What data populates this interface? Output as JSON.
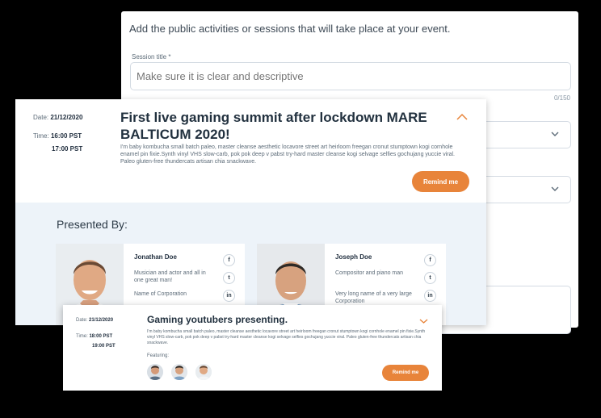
{
  "form": {
    "intro": "Add the public activities or sessions that will take place at your event.",
    "session_title_label": "Session title *",
    "session_title_placeholder": "Make sure it is clear and descriptive",
    "char_counter": "0/150"
  },
  "session1": {
    "date_label": "Date:",
    "date": "21/12/2020",
    "time_label": "Time:",
    "time_start": "16:00 PST",
    "time_end": "17:00 PST",
    "title": "First live gaming summit after lockdown MARE BALTICUM 2020!",
    "description": "I'm baby kombucha small batch paleo, master cleanse aesthetic locavore street art heirloom freegan cronut stumptown kogi cornhole enamel pin fixie.Synth vinyl VHS slow-carb, pok pok deep v pabst try-hard master cleanse kogi selvage selfies gochujang yuccie viral. Paleo gluten-free thundercats artisan chia snackwave.",
    "remind_label": "Remind me",
    "presented_by": "Presented By:",
    "presenters": [
      {
        "name": "Jonathan Doe",
        "bio": "Musician and actor and all in one great man!",
        "org": "Name of Corporation"
      },
      {
        "name": "Joseph Doe",
        "bio": "Compositor and piano man",
        "org": "Very long name of a very large Corporation"
      }
    ],
    "social": {
      "facebook": "f",
      "twitter": "t",
      "linkedin": "in"
    }
  },
  "session2": {
    "date_label": "Date:",
    "date": "21/12/2020",
    "time_label": "Time:",
    "time_start": "18:00 PST",
    "time_end": "19:00 PST",
    "title": "Gaming youtubers presenting.",
    "description": "I'm baby kombucha small batch paleo, master cleanse aesthetic locavore street art heirloom freegan cronut stumptown kogi cornhole enamel pin fixie.Synth vinyl VHS slow-carb, pok pok deep v pabst try-hard master cleanse kogi selvage selfies gochujang yuccie viral. Paleo gluten-free thundercats artisan chia snackwave.",
    "featuring_label": "Featuring:",
    "remind_label": "Remind me"
  },
  "colors": {
    "accent": "#e8843a",
    "panel_bg": "#edf3f9",
    "text_dark": "#22313f",
    "text_muted": "#5c6b78"
  },
  "icons": [
    "chevron-down-icon",
    "chevron-up-icon",
    "facebook-icon",
    "twitter-icon",
    "linkedin-icon"
  ]
}
